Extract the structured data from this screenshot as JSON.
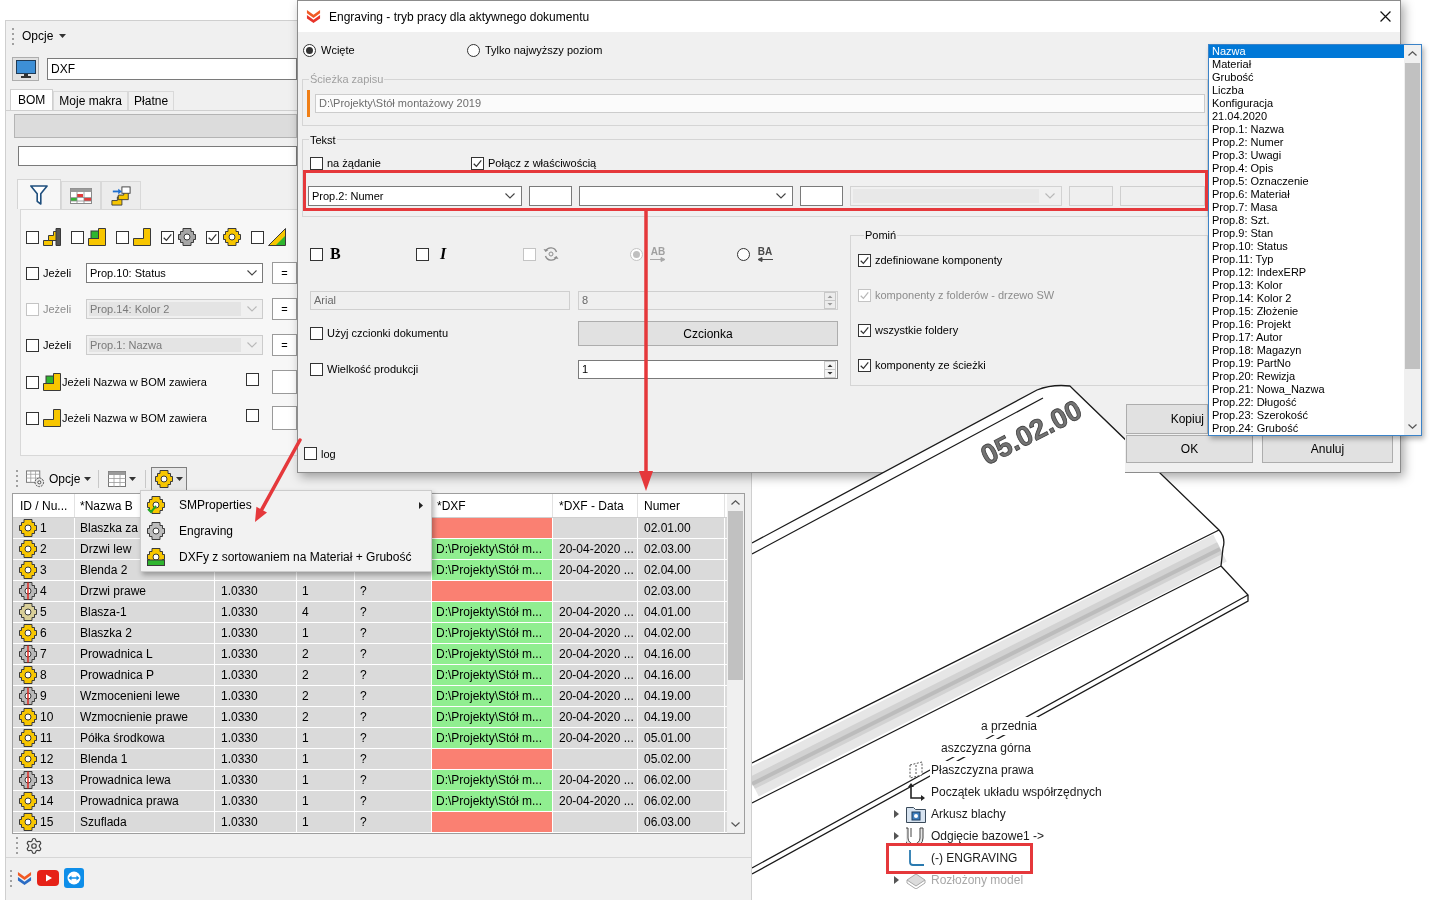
{
  "left_panel": {
    "toolbar": {
      "menu": "Opcje"
    },
    "profile": {
      "value": "DXF"
    },
    "tabs": [
      {
        "label": "BOM",
        "selected": true
      },
      {
        "label": "Moje makra",
        "selected": false
      },
      {
        "label": "Płatne",
        "selected": false
      }
    ],
    "view_tabs": [
      {
        "kind": "filter",
        "selected": true
      },
      {
        "kind": "table",
        "selected": false
      },
      {
        "kind": "transfer",
        "selected": false
      }
    ],
    "type_filters": [
      {
        "kind": "assembly",
        "checked": false
      },
      {
        "kind": "flagged",
        "checked": false
      },
      {
        "kind": "part",
        "checked": false
      },
      {
        "kind": "fastener",
        "checked": true
      },
      {
        "kind": "component",
        "checked": true
      },
      {
        "kind": "sheet",
        "checked": false
      }
    ],
    "conditions": [
      {
        "label": "Jeżeli",
        "checked": false,
        "disabled": false,
        "property": "Prop.10: Status",
        "property_disabled": false,
        "operator": "="
      },
      {
        "label": "Jeżeli",
        "checked": false,
        "disabled": true,
        "property": "Prop.14: Kolor 2",
        "property_disabled": true,
        "operator": "="
      },
      {
        "label": "Jeżeli",
        "checked": false,
        "disabled": false,
        "property": "Prop.1: Nazwa",
        "property_disabled": true,
        "operator": "="
      }
    ],
    "name_filters": [
      {
        "kind": "flagged",
        "checked": false,
        "label": "Jeżeli Nazwa w BOM zawiera",
        "flag_checked": false
      },
      {
        "kind": "part",
        "checked": false,
        "label": "Jeżeli Nazwa w BOM zawiera",
        "flag_checked": false
      }
    ]
  },
  "bom_toolbar": {
    "label": "Opcje",
    "buttons": [
      {
        "kind": "columns",
        "pressed": false
      },
      {
        "kind": "macros",
        "pressed": true
      }
    ]
  },
  "context_menu": {
    "items": [
      {
        "kind": "properties",
        "label": "SMProperties",
        "submenu": true
      },
      {
        "kind": "engraving",
        "label": "Engraving",
        "submenu": false
      },
      {
        "kind": "dxf",
        "label": "DXFy z sortowaniem na Materiał + Grubość",
        "submenu": false
      }
    ]
  },
  "table": {
    "columns": {
      "id": "ID / Nu...",
      "name": "*Nazwa B",
      "dxf": "*DXF",
      "dxf_date": "*DXF - Data",
      "number": "Numer"
    },
    "rows": [
      {
        "kind": "part",
        "id": "1",
        "name": "Blaszka za",
        "dxf": {
          "color": "#fa8072"
        },
        "number": "02.01.00"
      },
      {
        "kind": "part",
        "id": "2",
        "name": "Drzwi lew",
        "dxf": {
          "value": "D:\\Projekty\\Stół m...",
          "color": "#90ee90"
        },
        "dxf_date": "20-04-2020 ...",
        "number": "02.03.00"
      },
      {
        "kind": "part",
        "id": "3",
        "name": "Blenda 2",
        "dxf": {
          "value": "D:\\Projekty\\Stół m...",
          "color": "#90ee90"
        },
        "dxf_date": "20-04-2020 ...",
        "number": "02.04.00"
      },
      {
        "kind": "mirrored",
        "id": "4",
        "name": "Drzwi prawe",
        "column_3": "1.0330",
        "column_4": "1",
        "column_5": "?",
        "dxf": {
          "color": "#fa8072"
        },
        "number": "02.03.00"
      },
      {
        "kind": "plain",
        "id": "5",
        "name": "Blasza-1",
        "column_3": "1.0330",
        "column_4": "4",
        "column_5": "?",
        "dxf": {
          "value": "D:\\Projekty\\Stół m...",
          "color": "#90ee90"
        },
        "dxf_date": "20-04-2020 ...",
        "number": "04.01.00"
      },
      {
        "kind": "part",
        "id": "6",
        "name": "Blaszka 2",
        "column_3": "1.0330",
        "column_4": "1",
        "column_5": "?",
        "dxf": {
          "value": "D:\\Projekty\\Stół m...",
          "color": "#90ee90"
        },
        "dxf_date": "20-04-2020 ...",
        "number": "04.02.00"
      },
      {
        "kind": "mirrored",
        "id": "7",
        "name": "Prowadnica L",
        "column_3": "1.0330",
        "column_4": "2",
        "column_5": "?",
        "dxf": {
          "value": "D:\\Projekty\\Stół m...",
          "color": "#90ee90"
        },
        "dxf_date": "20-04-2020 ...",
        "number": "04.16.00"
      },
      {
        "kind": "part",
        "id": "8",
        "name": "Prowadnica P",
        "column_3": "1.0330",
        "column_4": "2",
        "column_5": "?",
        "dxf": {
          "value": "D:\\Projekty\\Stół m...",
          "color": "#90ee90"
        },
        "dxf_date": "20-04-2020 ...",
        "number": "04.16.00"
      },
      {
        "kind": "mirrored",
        "id": "9",
        "name": "Wzmocenieni lewe",
        "column_3": "1.0330",
        "column_4": "2",
        "column_5": "?",
        "dxf": {
          "value": "D:\\Projekty\\Stół m...",
          "color": "#90ee90"
        },
        "dxf_date": "20-04-2020 ...",
        "number": "04.19.00"
      },
      {
        "kind": "part",
        "id": "10",
        "name": "Wzmocnienie prawe",
        "column_3": "1.0330",
        "column_4": "2",
        "column_5": "?",
        "dxf": {
          "value": "D:\\Projekty\\Stół m...",
          "color": "#90ee90"
        },
        "dxf_date": "20-04-2020 ...",
        "number": "04.19.00"
      },
      {
        "kind": "part",
        "id": "11",
        "name": "Półka środkowa",
        "column_3": "1.0330",
        "column_4": "1",
        "column_5": "?",
        "dxf": {
          "value": "D:\\Projekty\\Stół m...",
          "color": "#90ee90"
        },
        "dxf_date": "20-04-2020 ...",
        "number": "05.01.00"
      },
      {
        "kind": "part",
        "id": "12",
        "name": "Blenda 1",
        "column_3": "1.0330",
        "column_4": "1",
        "column_5": "?",
        "dxf": {
          "color": "#fa8072"
        },
        "number": "05.02.00"
      },
      {
        "kind": "mirrored",
        "id": "13",
        "name": "Prowadnica lewa",
        "column_3": "1.0330",
        "column_4": "1",
        "column_5": "?",
        "dxf": {
          "value": "D:\\Projekty\\Stół m...",
          "color": "#90ee90"
        },
        "dxf_date": "20-04-2020 ...",
        "number": "06.02.00"
      },
      {
        "kind": "part",
        "id": "14",
        "name": "Prowadnica prawa",
        "column_3": "1.0330",
        "column_4": "1",
        "column_5": "?",
        "dxf": {
          "value": "D:\\Projekty\\Stół m...",
          "color": "#90ee90"
        },
        "dxf_date": "20-04-2020 ...",
        "number": "06.02.00"
      },
      {
        "kind": "part",
        "id": "15",
        "name": "Szuflada",
        "column_3": "1.0330",
        "column_4": "1",
        "column_5": "?",
        "dxf": {
          "color": "#fa8072"
        },
        "number": "06.03.00"
      }
    ]
  },
  "dialog": {
    "title": "Engraving - tryb pracy dla aktywnego dokumentu",
    "scope": [
      {
        "label": "Wcięte",
        "selected": true
      },
      {
        "label": "Tylko najwyższy poziom",
        "selected": false
      }
    ],
    "save_path": {
      "legend": "Ścieżka zapisu",
      "value": "D:\\Projekty\\Stół montażowy 2019",
      "disabled": true
    },
    "text": {
      "legend": "Tekst",
      "options": [
        {
          "label": "na żądanie",
          "checked": false
        },
        {
          "label": "Połącz z właściwością",
          "checked": true
        }
      ],
      "source": [
        {
          "kind": "select",
          "value": "Prop.2: Numer",
          "disabled": false
        },
        {
          "kind": "input",
          "disabled": false
        },
        {
          "kind": "select",
          "disabled": false
        },
        {
          "kind": "input",
          "disabled": false
        },
        {
          "kind": "select",
          "disabled": true
        },
        {
          "kind": "input",
          "disabled": true
        },
        {
          "kind": "input",
          "disabled": true
        }
      ],
      "style": [
        {
          "kind": "bold",
          "label": "B",
          "checked": false,
          "disabled": false
        },
        {
          "kind": "italic",
          "label": "I",
          "checked": false,
          "disabled": false
        },
        {
          "kind": "rotate",
          "checked": false,
          "disabled": true
        },
        {
          "kind": "forward",
          "label": "AB",
          "selected": true,
          "disabled": true
        },
        {
          "kind": "reverse",
          "label": "BA",
          "selected": false,
          "disabled": false
        }
      ],
      "font": {
        "value": "Arial",
        "disabled": true
      },
      "size": {
        "value": "8",
        "disabled": true
      },
      "use_document_font": {
        "label": "Użyj czcionki dokumentu",
        "checked": false
      },
      "font_button": "Czcionka",
      "production_size": {
        "label": "Wielkość produkcji",
        "checked": false,
        "value": "1"
      }
    },
    "log": {
      "label": "log",
      "checked": false
    },
    "skip": {
      "legend": "Pomiń",
      "options": [
        {
          "label": "zdefiniowane komponenty",
          "checked": true,
          "disabled": false
        },
        {
          "label": "komponenty z folderów - drzewo SW",
          "checked": true,
          "disabled": true
        },
        {
          "label": "wszystkie foldery",
          "checked": true,
          "disabled": false
        },
        {
          "label": "komponenty ze ścieżki",
          "checked": true,
          "disabled": false
        }
      ]
    },
    "buttons": [
      "Kopiuj",
      "OK",
      "Anuluj"
    ]
  },
  "property_list": {
    "items": [
      {
        "label": "Nazwa",
        "selected": true
      },
      {
        "label": "Materiał",
        "selected": false
      },
      {
        "label": "Grubość",
        "selected": false
      },
      {
        "label": "Liczba",
        "selected": false
      },
      {
        "label": "Konfiguracja",
        "selected": false
      },
      {
        "label": "21.04.2020",
        "selected": false
      },
      {
        "label": "Prop.1: Nazwa",
        "selected": false
      },
      {
        "label": "Prop.2: Numer",
        "selected": false
      },
      {
        "label": "Prop.3: Uwagi",
        "selected": false
      },
      {
        "label": "Prop.4: Opis",
        "selected": false
      },
      {
        "label": "Prop.5: Oznaczenie",
        "selected": false
      },
      {
        "label": "Prop.6: Materiał",
        "selected": false
      },
      {
        "label": "Prop.7: Masa",
        "selected": false
      },
      {
        "label": "Prop.8: Szt.",
        "selected": false
      },
      {
        "label": "Prop.9: Stan",
        "selected": false
      },
      {
        "label": "Prop.10: Status",
        "selected": false
      },
      {
        "label": "Prop.11: Typ",
        "selected": false
      },
      {
        "label": "Prop.12: IndexERP",
        "selected": false
      },
      {
        "label": "Prop.13: Kolor",
        "selected": false
      },
      {
        "label": "Prop.14: Kolor 2",
        "selected": false
      },
      {
        "label": "Prop.15: Złożenie",
        "selected": false
      },
      {
        "label": "Prop.16: Projekt",
        "selected": false
      },
      {
        "label": "Prop.17: Autor",
        "selected": false
      },
      {
        "label": "Prop.18: Magazyn",
        "selected": false
      },
      {
        "label": "Prop.19: PartNo",
        "selected": false
      },
      {
        "label": "Prop.20: Rewizja",
        "selected": false
      },
      {
        "label": "Prop.21: Nowa_Nazwa",
        "selected": false
      },
      {
        "label": "Prop.22: Długość",
        "selected": false
      },
      {
        "label": "Prop.23: Szerokość",
        "selected": false
      },
      {
        "label": "Prop.24: Grubość",
        "selected": false
      }
    ]
  },
  "model_view": {
    "engraving": "05.02.00",
    "tree": [
      {
        "label": "a przednia",
        "suppressed": false
      },
      {
        "label": "aszczyzna górna",
        "suppressed": false
      },
      {
        "kind": "plane",
        "label": "Płaszczyzna prawa",
        "suppressed": false
      },
      {
        "kind": "origin",
        "label": "Początek układu współrzędnych",
        "suppressed": false
      },
      {
        "kind": "sheet",
        "label": "Arkusz blachy",
        "expanded": false,
        "suppressed": false
      },
      {
        "kind": "bend",
        "label": "Odgięcie bazowe1 ->",
        "expanded": false,
        "suppressed": false
      },
      {
        "kind": "sketch",
        "label": "(-) ENGRAVING",
        "suppressed": false
      },
      {
        "kind": "flat",
        "label": "Rozłożony model",
        "expanded": false,
        "suppressed": true
      }
    ]
  }
}
